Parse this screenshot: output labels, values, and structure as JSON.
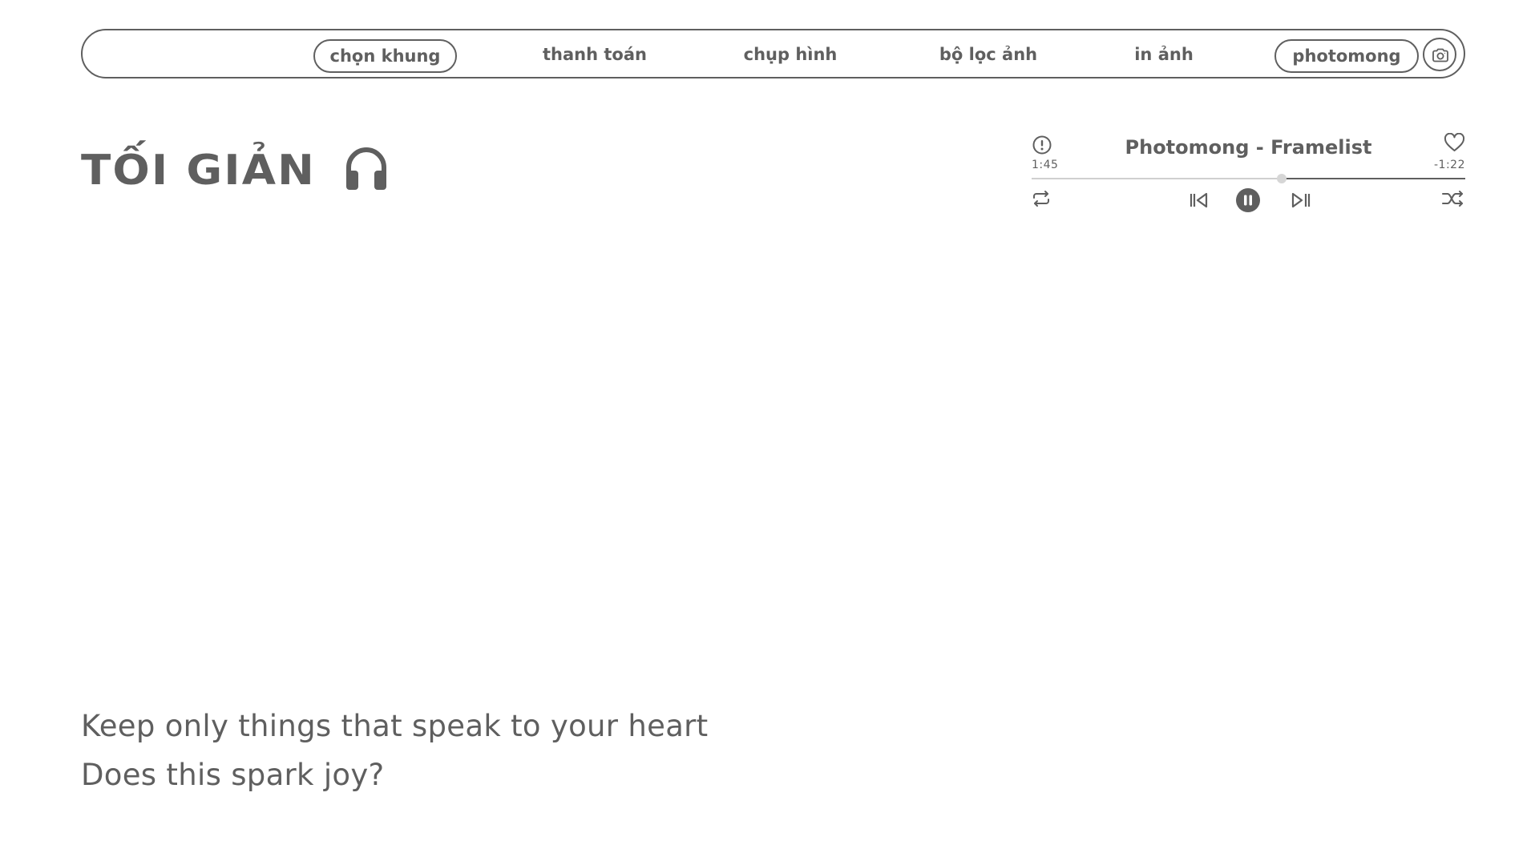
{
  "nav": {
    "items": [
      {
        "label": "chọn khung",
        "active": true
      },
      {
        "label": "thanh toán"
      },
      {
        "label": "chụp hình"
      },
      {
        "label": "bộ lọc ảnh"
      },
      {
        "label": "in ảnh"
      }
    ],
    "brand_label": "photomong",
    "camera_icon": "camera-icon"
  },
  "page": {
    "title": "TỐI GIẢN",
    "title_icon": "headphones-icon"
  },
  "player": {
    "track": "Photomong - Framelist",
    "elapsed": "1:45",
    "remaining": "-1:22",
    "progress": 0.577,
    "state": "playing",
    "icons": {
      "info": "info-icon",
      "favorite": "heart-icon",
      "repeat": "repeat-icon",
      "previous": "skip-back-icon",
      "pause": "pause-icon",
      "next": "skip-forward-icon",
      "shuffle": "shuffle-icon"
    }
  },
  "quote": {
    "line1": "Keep only things that speak to your heart",
    "line2": "Does this spark joy?"
  },
  "colors": {
    "foreground": "#5f5f5f",
    "background": "#ffffff",
    "progress_played": "#cfcfcf"
  }
}
